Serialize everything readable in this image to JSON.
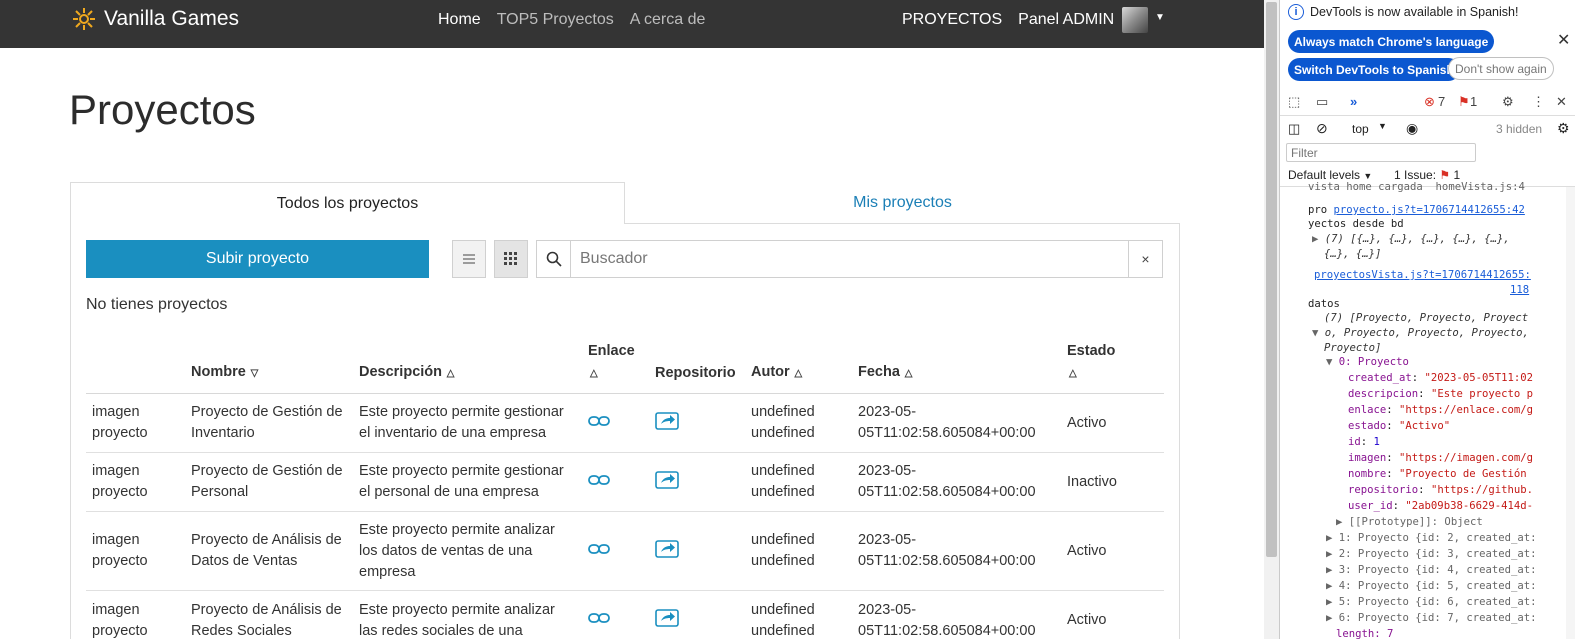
{
  "navbar": {
    "brand": "Vanilla Games",
    "links": [
      "Home",
      "TOP5 Proyectos",
      "A cerca de"
    ],
    "right_links": [
      "PROYECTOS",
      "Panel ADMIN"
    ]
  },
  "page": {
    "title": "Proyectos",
    "tabs": [
      "Todos los proyectos",
      "Mis proyectos"
    ],
    "upload_button": "Subir proyecto",
    "search_placeholder": "Buscador",
    "clear_symbol": "×",
    "empty_message": "No tienes proyectos"
  },
  "table": {
    "headers": {
      "nombre": "Nombre",
      "descripcion": "Descripción",
      "enlace": "Enlace",
      "repositorio": "Repositorio",
      "autor": "Autor",
      "fecha": "Fecha",
      "estado": "Estado"
    },
    "rows": [
      {
        "img_alt": "imagen proyecto",
        "nombre": "Proyecto de Gestión de Inventario",
        "descripcion": "Este proyecto permite gestionar el inventario de una empresa",
        "autor": "undefined undefined",
        "fecha": "2023-05-05T11:02:58.605084+00:00",
        "estado": "Activo"
      },
      {
        "img_alt": "imagen proyecto",
        "nombre": "Proyecto de Gestión de Personal",
        "descripcion": "Este proyecto permite gestionar el personal de una empresa",
        "autor": "undefined undefined",
        "fecha": "2023-05-05T11:02:58.605084+00:00",
        "estado": "Inactivo"
      },
      {
        "img_alt": "imagen proyecto",
        "nombre": "Proyecto de Análisis de Datos de Ventas",
        "descripcion": "Este proyecto permite analizar los datos de ventas de una empresa",
        "autor": "undefined undefined",
        "fecha": "2023-05-05T11:02:58.605084+00:00",
        "estado": "Activo"
      },
      {
        "img_alt": "imagen proyecto",
        "nombre": "Proyecto de Análisis de Redes Sociales",
        "descripcion": "Este proyecto permite analizar las redes sociales de una",
        "autor": "undefined undefined",
        "fecha": "2023-05-05T11:02:58.605084+00:00",
        "estado": "Activo"
      }
    ]
  },
  "devtools": {
    "info": "DevTools is now available in Spanish!",
    "btn_match": "Always match Chrome's language",
    "btn_switch": "Switch DevTools to Spanish",
    "btn_dont_show": "Don't show again",
    "errors": "7",
    "warnings": "1",
    "context": "top",
    "hidden": "3 hidden",
    "filter_placeholder": "Filter",
    "levels": "Default levels",
    "issues_label": "1 Issue:",
    "issues_count": "1",
    "log_top": "vista home cargada  homeVista.js:4",
    "log_pro": "pro",
    "link1": "proyecto.js?t=1706714412655:42",
    "log_desde": "yectos desde bd",
    "arr1a": "(7) [{…}, {…}, {…}, {…}, {…},",
    "arr1b": "{…}, {…}]",
    "link2a": "proyectosVista.js?t=1706714412655:",
    "link2b": "118",
    "datos": "datos",
    "arr2a": "(7) [Proyecto, Proyecto, Proyect",
    "arr2b": "o, Proyecto, Proyecto, Proyecto,",
    "arr2c": "Proyecto]",
    "item0": "0: Proyecto",
    "fields": [
      [
        "created_at",
        "\"2023-05-05T11:02"
      ],
      [
        "descripcion",
        "\"Este proyecto p"
      ],
      [
        "enlace",
        "\"https://enlace.com/g"
      ],
      [
        "estado",
        "\"Activo\""
      ],
      [
        "id",
        "1"
      ],
      [
        "imagen",
        "\"https://imagen.com/g"
      ],
      [
        "nombre",
        "\"Proyecto de Gestión"
      ],
      [
        "repositorio",
        "\"https://github."
      ],
      [
        "user_id",
        "\"2ab09b38-6629-414d-"
      ]
    ],
    "prototype": "[[Prototype]]: Object",
    "items": [
      "1: Proyecto {id: 2, created_at:",
      "2: Proyecto {id: 3, created_at:",
      "3: Proyecto {id: 4, created_at:",
      "4: Proyecto {id: 5, created_at:",
      "5: Proyecto {id: 6, created_at:",
      "6: Proyecto {id: 7, created_at:"
    ],
    "length": "length: 7"
  }
}
